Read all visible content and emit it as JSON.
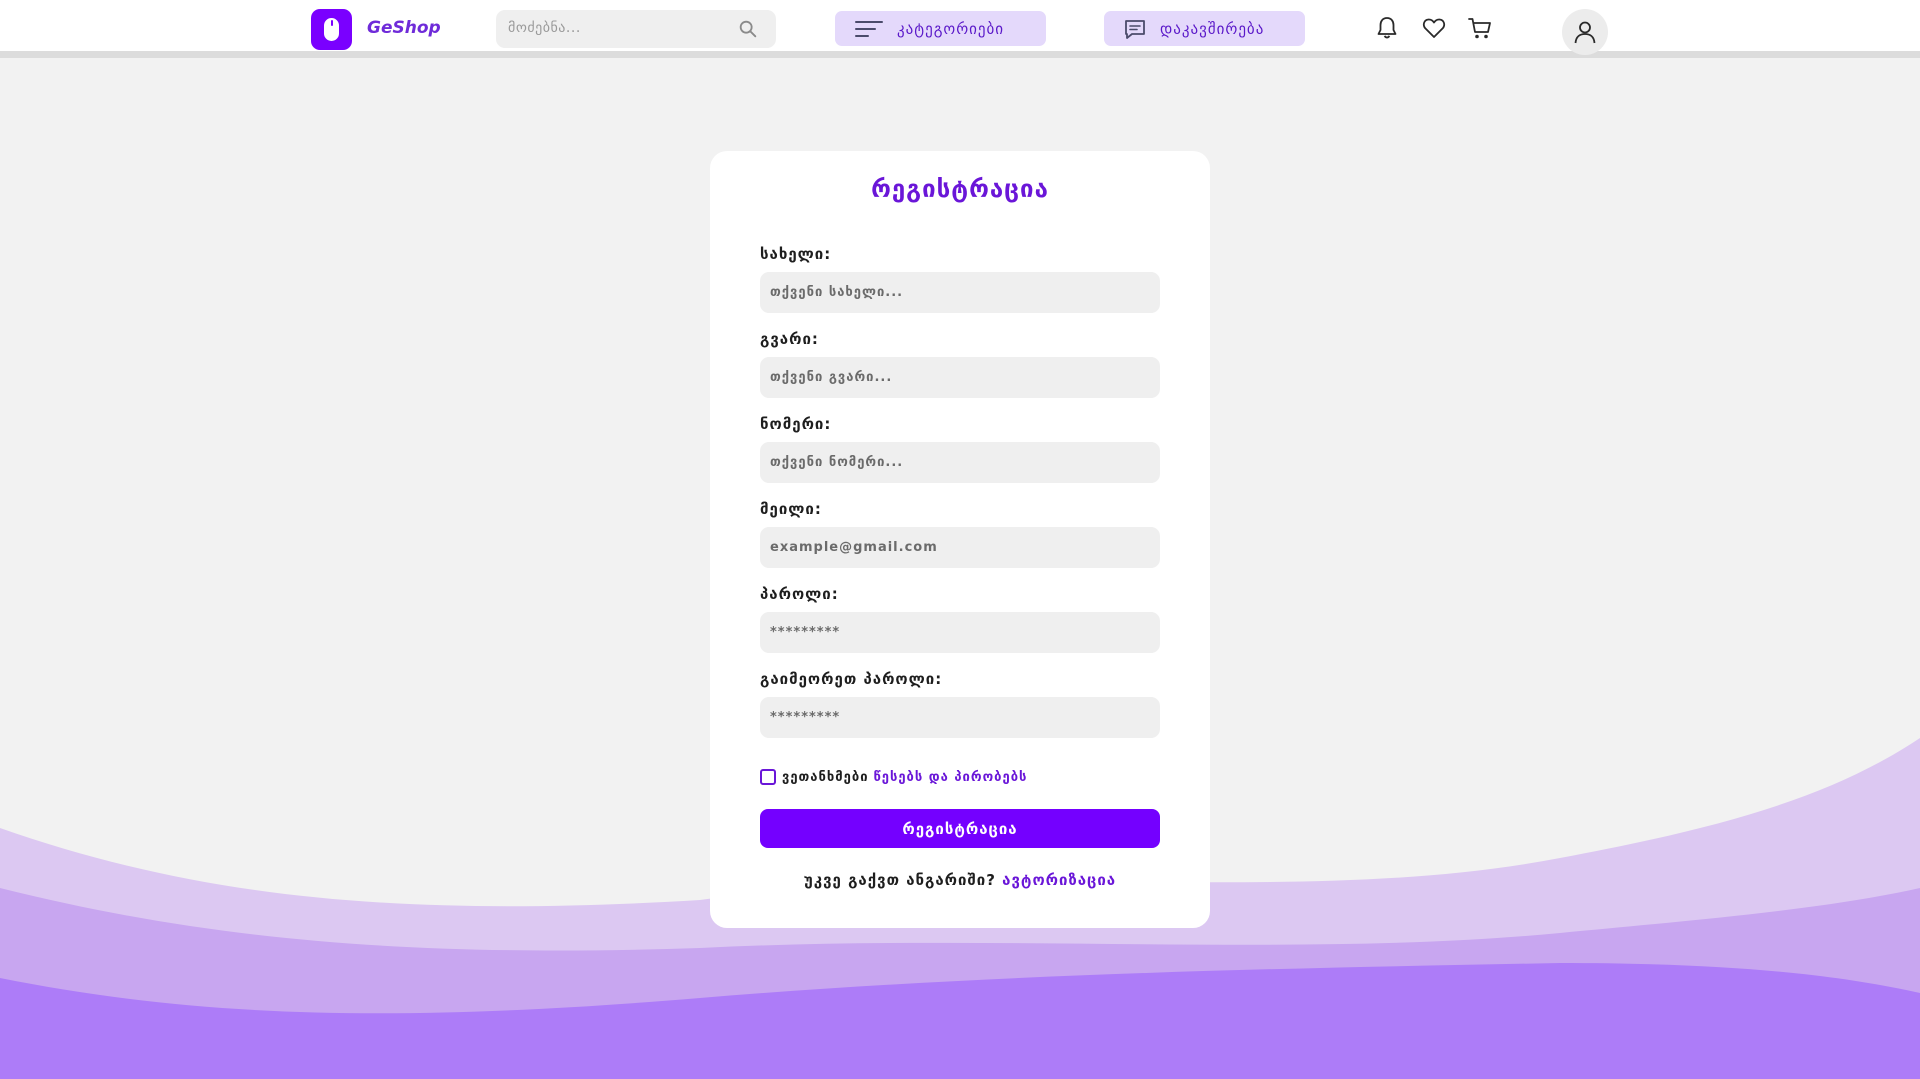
{
  "header": {
    "brand": "GeShop",
    "search_placeholder": "მოძებნა...",
    "categories_label": "კატეგორიები",
    "contact_label": "დაკავშირება",
    "icons": [
      "search-icon",
      "menu-icon",
      "chat-icon",
      "bell-icon",
      "heart-icon",
      "cart-icon",
      "user-icon"
    ]
  },
  "form": {
    "title": "რეგისტრაცია",
    "fields": [
      {
        "label": "სახელი:",
        "placeholder": "თქვენი სახელი..."
      },
      {
        "label": "გვარი:",
        "placeholder": "თქვენი გვარი..."
      },
      {
        "label": "ნომერი:",
        "placeholder": "თქვენი ნომერი..."
      },
      {
        "label": "მეილი:",
        "placeholder": "example@gmail.com"
      },
      {
        "label": "პაროლი:",
        "placeholder": "*********"
      },
      {
        "label": "გაიმეორეთ პაროლი:",
        "placeholder": "*********"
      }
    ],
    "agree_text": "ვეთანხმები",
    "terms_link": "წესებს და პირობებს",
    "submit_label": "რეგისტრაცია",
    "have_account": "უკვე გაქვთ ანგარიში?",
    "login_link": "ავტორიზაცია"
  },
  "colors": {
    "accent": "#7400ff",
    "accent_text": "#6a16d8",
    "nav_button_bg": "#e4d9fb",
    "wave_light": "#dcc8f2",
    "wave_mid": "#c8a6f0",
    "wave_dark": "#ad7cf8"
  }
}
